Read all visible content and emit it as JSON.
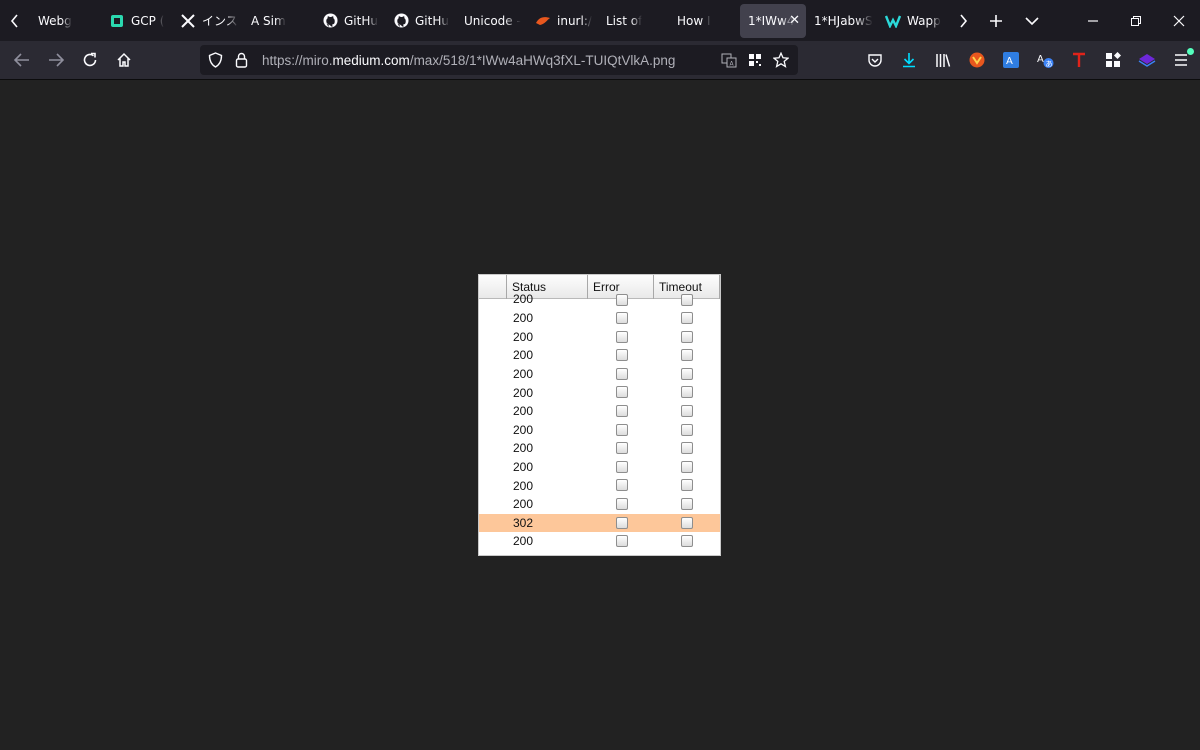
{
  "tabs": [
    {
      "label": "Webg",
      "icon": "none"
    },
    {
      "label": "GCP (",
      "icon": "gcp-icon"
    },
    {
      "label": "インス",
      "icon": "x-icon"
    },
    {
      "label": "A Sim",
      "icon": "none"
    },
    {
      "label": "GitHu",
      "icon": "github-icon"
    },
    {
      "label": "GitHu",
      "icon": "github-icon"
    },
    {
      "label": "Unicode -",
      "icon": "none"
    },
    {
      "label": "inurl:/",
      "icon": "bird-icon"
    },
    {
      "label": "List of",
      "icon": "none"
    },
    {
      "label": "How I",
      "icon": "none"
    },
    {
      "label": "1*IWw4",
      "icon": "none",
      "active": true
    },
    {
      "label": "1*HJabwS",
      "icon": "none"
    },
    {
      "label": "Wapp",
      "icon": "wappalyzer-icon"
    }
  ],
  "url": {
    "prefix": "https://miro.",
    "domain": "medium.com",
    "path": "/max/518/1*IWw4aHWq3fXL-TUIQtVlkA.png"
  },
  "table": {
    "headers": {
      "status": "Status",
      "error": "Error",
      "timeout": "Timeout"
    },
    "rows": [
      {
        "status": "200",
        "highlight": false
      },
      {
        "status": "200",
        "highlight": false
      },
      {
        "status": "200",
        "highlight": false
      },
      {
        "status": "200",
        "highlight": false
      },
      {
        "status": "200",
        "highlight": false
      },
      {
        "status": "200",
        "highlight": false
      },
      {
        "status": "200",
        "highlight": false
      },
      {
        "status": "200",
        "highlight": false
      },
      {
        "status": "200",
        "highlight": false
      },
      {
        "status": "200",
        "highlight": false
      },
      {
        "status": "200",
        "highlight": false
      },
      {
        "status": "200",
        "highlight": false
      },
      {
        "status": "302",
        "highlight": true
      },
      {
        "status": "200",
        "highlight": false
      }
    ],
    "highlight_color": "#fdc79a"
  },
  "colors": {
    "tabbar_bg": "#1c1b22",
    "navbar_bg": "#2b2a33",
    "viewport_bg": "#222222",
    "active_tab_bg": "#42414d"
  }
}
